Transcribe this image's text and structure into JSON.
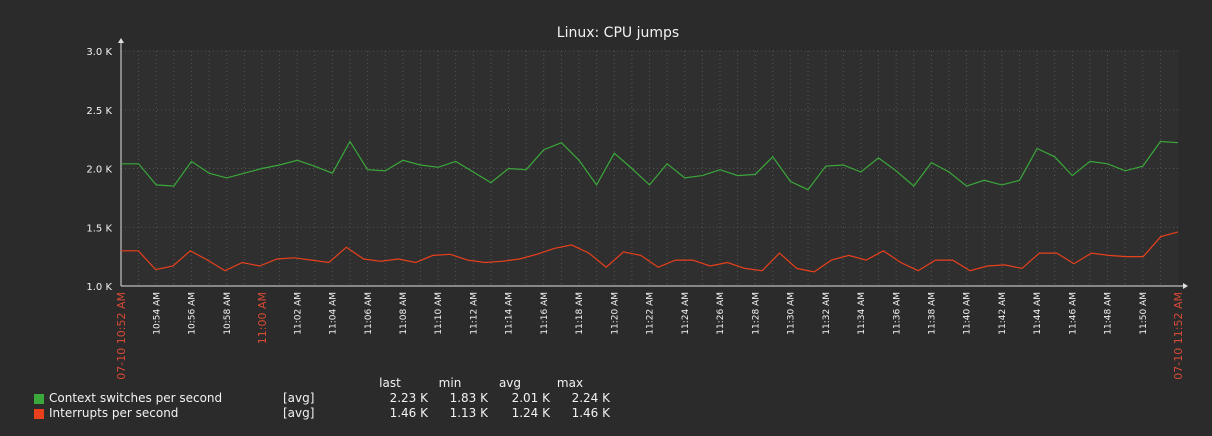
{
  "chart_data": {
    "type": "line",
    "title": "Linux: CPU jumps",
    "ylim": [
      1000,
      3000
    ],
    "y_ticks": [
      "1.0 K",
      "1.5 K",
      "2.0 K",
      "2.5 K",
      "3.0 K"
    ],
    "y_tick_values": [
      1000,
      1500,
      2000,
      2500,
      3000
    ],
    "x_start_label": "07-10 10:52 AM",
    "x_end_label": "07-10 11:52 AM",
    "x_tick_labels": [
      "10:54 AM",
      "10:56 AM",
      "10:58 AM",
      "11:00 AM",
      "11:02 AM",
      "11:04 AM",
      "11:06 AM",
      "11:08 AM",
      "11:10 AM",
      "11:12 AM",
      "11:14 AM",
      "11:16 AM",
      "11:18 AM",
      "11:20 AM",
      "11:22 AM",
      "11:24 AM",
      "11:26 AM",
      "11:28 AM",
      "11:30 AM",
      "11:32 AM",
      "11:34 AM",
      "11:36 AM",
      "11:38 AM",
      "11:40 AM",
      "11:42 AM",
      "11:44 AM",
      "11:46 AM",
      "11:48 AM",
      "11:50 AM"
    ],
    "x_tick_highlight": "11:00 AM",
    "grid": true,
    "legend_position": "bottom-left",
    "series": [
      {
        "name": "Context switches per second",
        "color": "#3aa83a",
        "values": [
          2040,
          2040,
          1860,
          1850,
          2060,
          1960,
          1920,
          1960,
          2000,
          2030,
          2070,
          2020,
          1960,
          2230,
          1990,
          1980,
          2070,
          2030,
          2010,
          2060,
          1970,
          1880,
          2000,
          1990,
          2160,
          2220,
          2070,
          1860,
          2130,
          2000,
          1860,
          2040,
          1920,
          1940,
          1990,
          1940,
          1950,
          2100,
          1890,
          1820,
          2020,
          2030,
          1970,
          2090,
          1980,
          1850,
          2050,
          1970,
          1850,
          1900,
          1860,
          1900,
          2170,
          2100,
          1940,
          2060,
          2040,
          1980,
          2020,
          2230,
          2220
        ]
      },
      {
        "name": "Interrupts per second",
        "color": "#e8401c",
        "values": [
          1300,
          1300,
          1140,
          1170,
          1300,
          1220,
          1130,
          1200,
          1170,
          1230,
          1240,
          1220,
          1200,
          1330,
          1230,
          1210,
          1230,
          1200,
          1260,
          1270,
          1220,
          1200,
          1210,
          1230,
          1270,
          1320,
          1350,
          1280,
          1160,
          1290,
          1260,
          1160,
          1220,
          1220,
          1170,
          1200,
          1150,
          1130,
          1280,
          1150,
          1120,
          1220,
          1260,
          1220,
          1300,
          1200,
          1130,
          1220,
          1220,
          1130,
          1170,
          1180,
          1150,
          1280,
          1280,
          1190,
          1280,
          1260,
          1250,
          1250,
          1420,
          1460
        ]
      }
    ]
  },
  "legend": {
    "headers": [
      "last",
      "min",
      "avg",
      "max"
    ],
    "rows": [
      {
        "name": "Context switches per second",
        "func": "[avg]",
        "last": "2.23 K",
        "min": "1.83 K",
        "avg": "2.01 K",
        "max": "2.24 K",
        "color": "#3aa83a"
      },
      {
        "name": "Interrupts per second",
        "func": "[avg]",
        "last": "1.46 K",
        "min": "1.13 K",
        "avg": "1.24 K",
        "max": "1.46 K",
        "color": "#e8401c"
      }
    ]
  }
}
